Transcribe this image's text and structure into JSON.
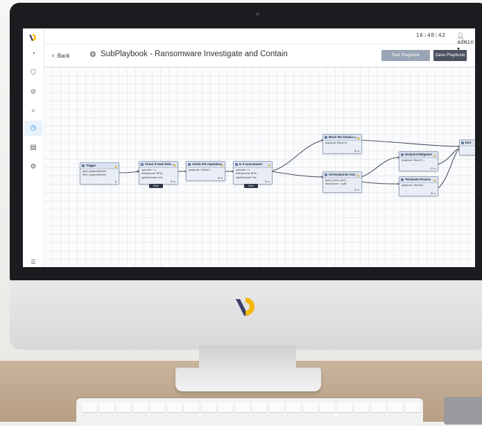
{
  "topbar": {
    "clock": "16:40:42",
    "user": "admin",
    "user_icon": "person-icon",
    "caret": "▾"
  },
  "titlebar": {
    "back_label": "Back",
    "title": "SubPlaybook - Ransomware Investigate and Contain",
    "title_icon": "gear-icon",
    "test_button": "Test Playbook",
    "save_button": "Save Playbook"
  },
  "sidebar": {
    "items": [
      {
        "icon": "logo-icon"
      },
      {
        "icon": "dashboard-icon"
      },
      {
        "icon": "shield-icon"
      },
      {
        "icon": "bug-search-icon"
      },
      {
        "icon": "search-icon"
      },
      {
        "icon": "playbook-icon",
        "active": true
      },
      {
        "icon": "report-icon"
      },
      {
        "icon": "settings-icon"
      },
      {
        "icon": "menu-icon"
      }
    ]
  },
  "nodes": {
    "trigger": {
      "title": "Trigger",
      "rows": [
        "type: playbookEvent",
        "item: playbookEvent"
      ]
    },
    "check_hash": {
      "title": "Check if Hash field ...",
      "rows": [
        "operator: !==",
        "leftOperand: $ITA...",
        "rightOperand: null"
      ],
      "tag": "Else"
    },
    "check_file": {
      "title": "Check File reputation",
      "rows": [
        "playbook: Check F..."
      ]
    },
    "is_ransomware": {
      "title": "Is it ransomware",
      "rows": [
        "operator: ==",
        "leftOperand: $ITA...",
        "rightOperand: Ra..."
      ],
      "tag": "Else"
    },
    "block_domain": {
      "title": "Block the domain, I...",
      "rows": [
        "playbook: Block th..."
      ]
    },
    "get_endpoints": {
      "title": "Get Endpoints mat...",
      "rows": [
        "query: {scm_ips*}...",
        "dataSource: LogP..."
      ]
    },
    "endpoint_mitigation": {
      "title": "Endpoint Mitigation",
      "rows": [
        "playbook: Block H..."
      ]
    },
    "terminate_process": {
      "title": "Terminate Process",
      "rows": [
        "playbook: Termina..."
      ]
    },
    "end": {
      "title": "End",
      "rows": []
    }
  },
  "colors": {
    "accent": "#f5b800",
    "brand_dark": "#3c3f68",
    "save_btn": "#4a5160",
    "test_btn": "#9aa4b4"
  }
}
